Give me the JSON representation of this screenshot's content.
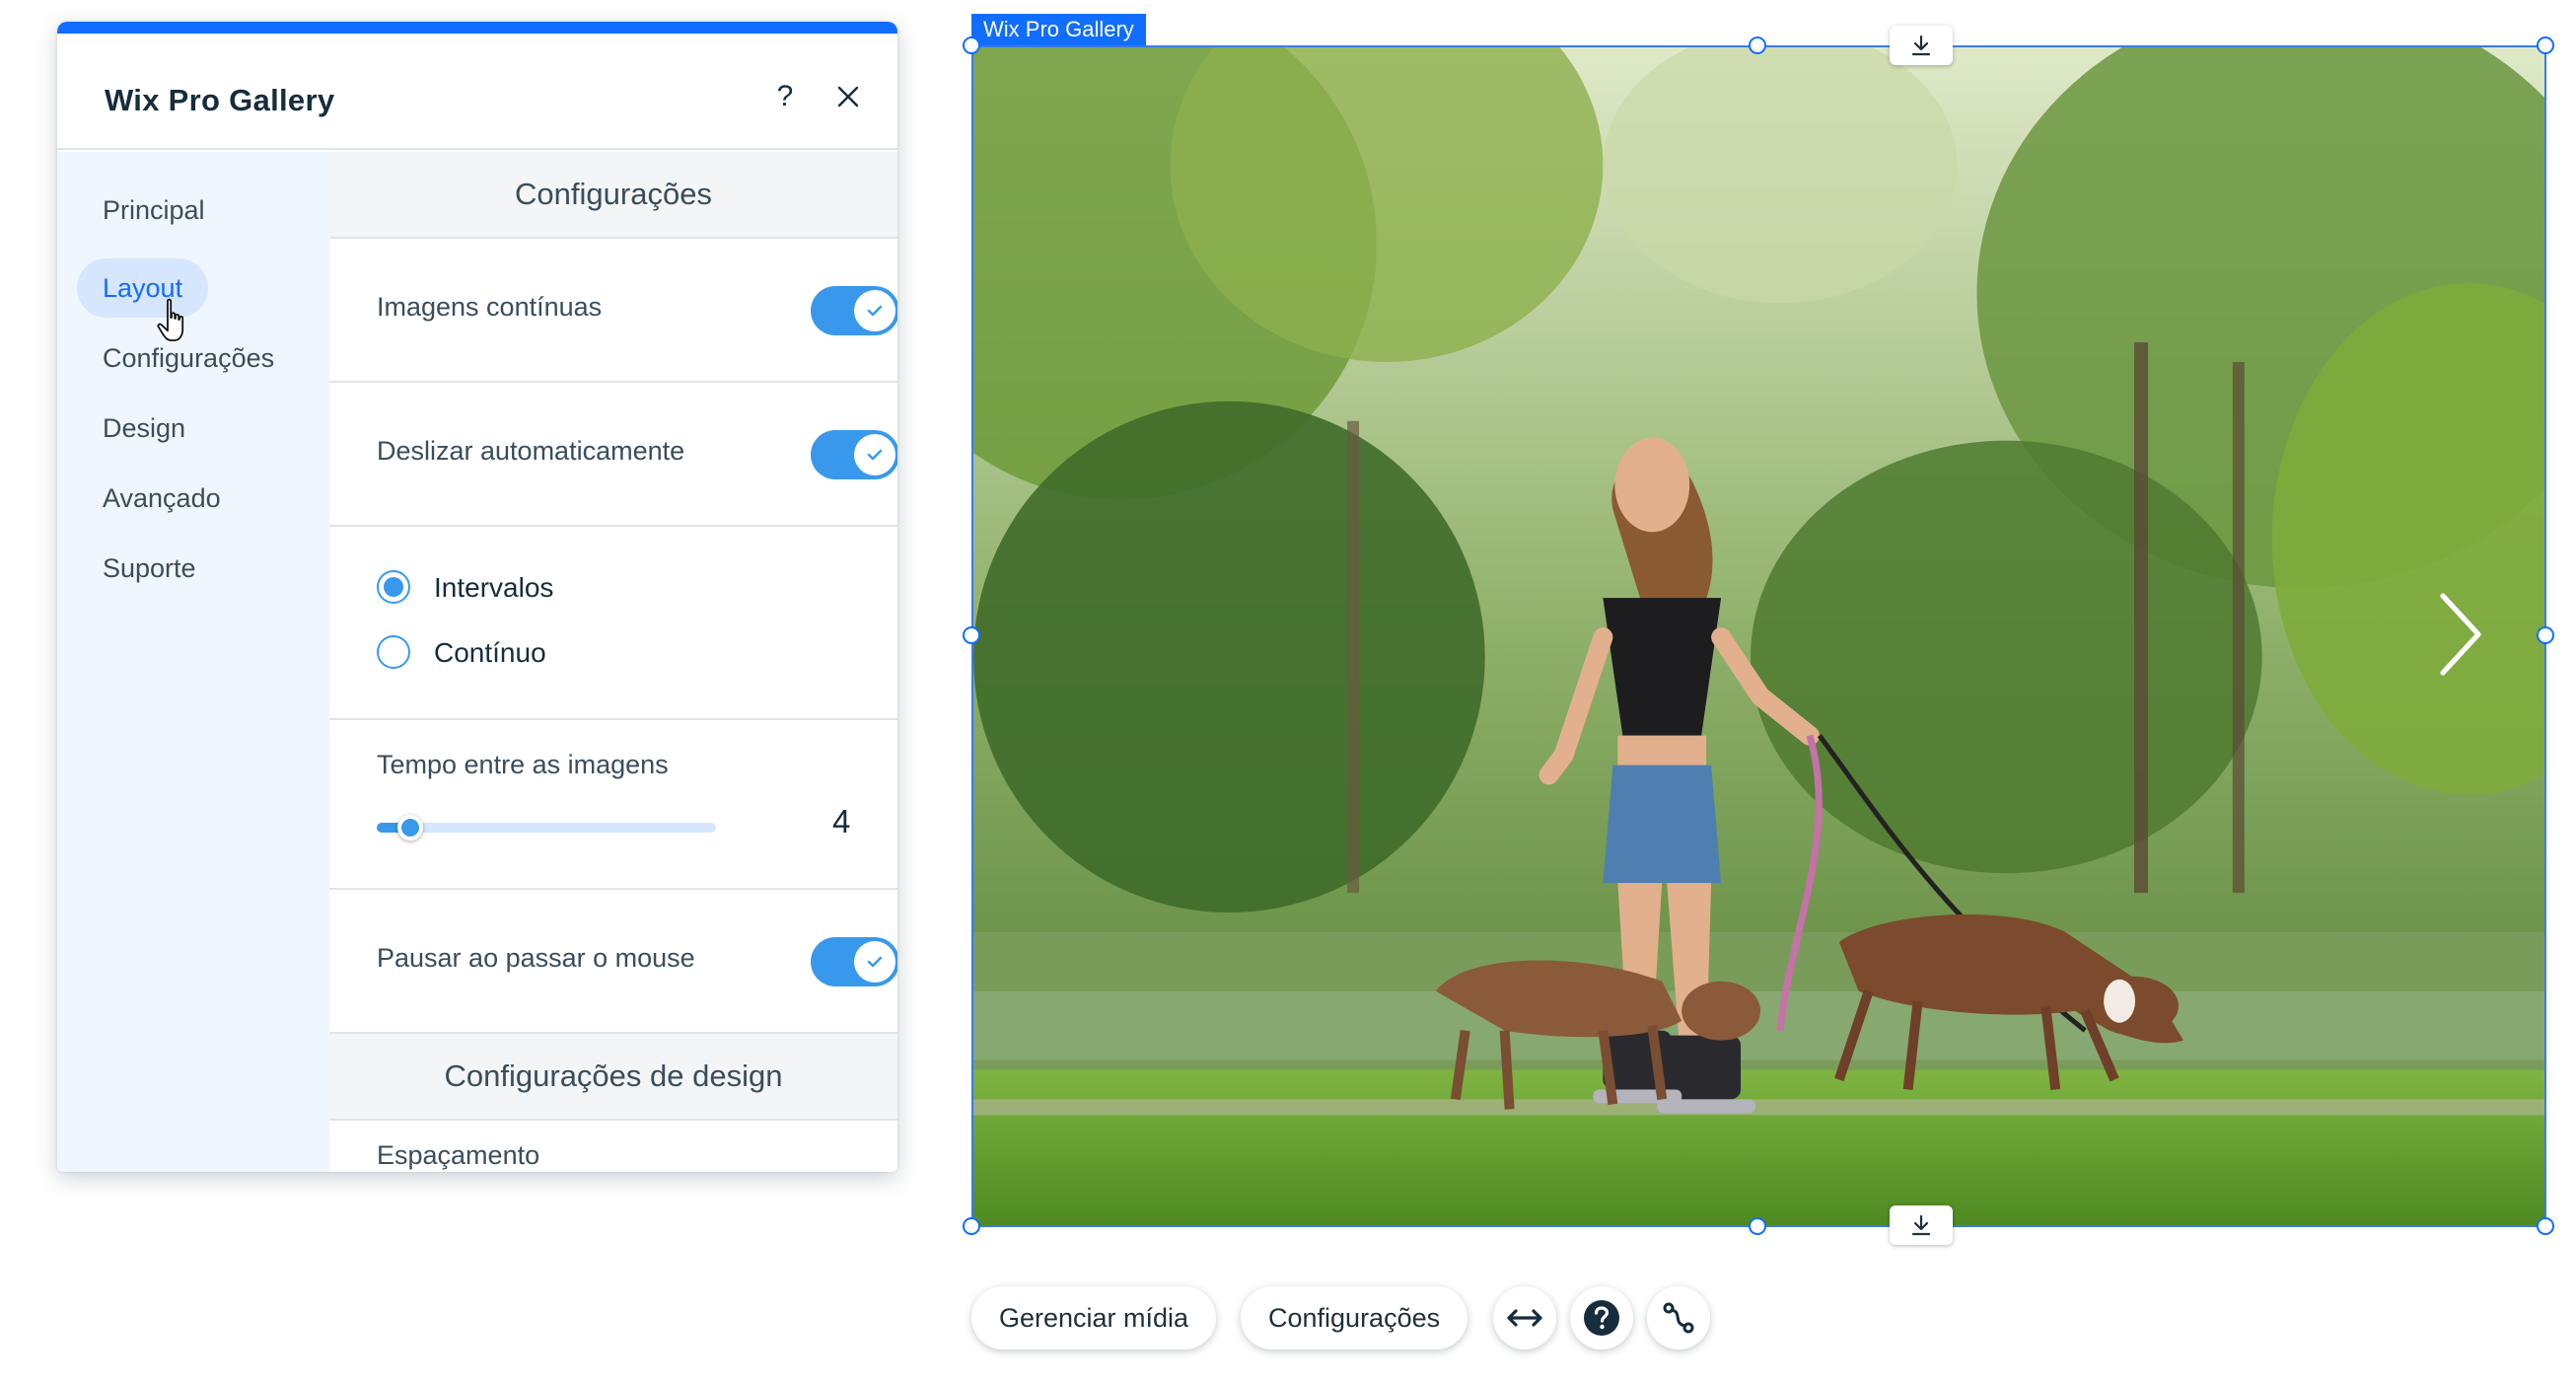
{
  "panel": {
    "title": "Wix Pro Gallery",
    "help_icon": "help-icon",
    "close_icon": "close-icon",
    "accent_color": "#116dff"
  },
  "sidebar": {
    "items": [
      {
        "label": "Principal",
        "active": false
      },
      {
        "label": "Layout",
        "active": true
      },
      {
        "label": "Configurações",
        "active": false
      },
      {
        "label": "Design",
        "active": false
      },
      {
        "label": "Avançado",
        "active": false
      },
      {
        "label": "Suporte",
        "active": false
      }
    ]
  },
  "settings": {
    "section_title": "Configurações",
    "continuous_images": {
      "label": "Imagens contínuas",
      "on": true
    },
    "autoslide": {
      "label": "Deslizar automaticamente",
      "on": true
    },
    "slide_mode": {
      "options": [
        "Intervalos",
        "Contínuo"
      ],
      "selected": "Intervalos"
    },
    "interval": {
      "label": "Tempo entre as imagens",
      "value": "4",
      "fraction": 0.1
    },
    "pause_on_hover": {
      "label": "Pausar ao passar o mouse",
      "on": true
    },
    "design_section_title": "Configurações de design",
    "spacing_label": "Espaçamento"
  },
  "canvas": {
    "selection_label": "Wix Pro Gallery",
    "selection_color": "#116dff",
    "next_icon": "chevron-right-icon"
  },
  "actions": {
    "manage_media": "Gerenciar mídia",
    "settings": "Configurações",
    "stretch_icon": "stretch-arrows-icon",
    "help_icon": "help-circle-icon",
    "connect_icon": "connect-data-icon"
  }
}
